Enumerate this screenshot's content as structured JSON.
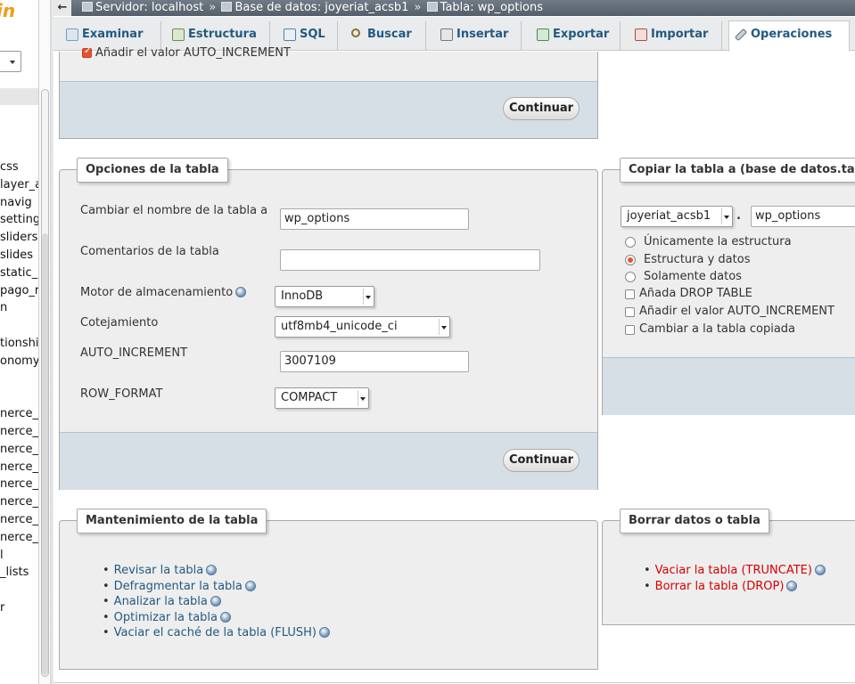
{
  "nav": {
    "logo_fragment": "in",
    "tree_items": [
      "css",
      "layer_a",
      "navig",
      "setting",
      "sliders",
      "slides",
      "static_",
      "pago_r",
      "n",
      "",
      "tionshi",
      "onomy",
      "",
      "",
      "nerce_a",
      "nerce_a",
      "nerce_c",
      "nerce_c",
      "nerce_c",
      "nerce_t",
      "nerce_t",
      "nerce_t",
      "l",
      "_lists",
      "",
      "r"
    ]
  },
  "breadcrumb": {
    "back_arrow": "←",
    "server": "Servidor: localhost",
    "sep": "»",
    "database": "Base de datos: joyeriat_acsb1",
    "table": "Tabla: wp_options"
  },
  "tabs": [
    {
      "label": "Examinar",
      "icon": "browse-icon"
    },
    {
      "label": "Estructura",
      "icon": "structure-icon"
    },
    {
      "label": "SQL",
      "icon": "sql-icon"
    },
    {
      "label": "Buscar",
      "icon": "search-icon"
    },
    {
      "label": "Insertar",
      "icon": "insert-icon"
    },
    {
      "label": "Exportar",
      "icon": "export-icon"
    },
    {
      "label": "Importar",
      "icon": "import-icon"
    },
    {
      "label": "Operaciones",
      "icon": "wrench-icon",
      "active": true
    }
  ],
  "top_section": {
    "checkbox_label": "Añadir el valor AUTO_INCREMENT",
    "button": "Continuar"
  },
  "table_options": {
    "legend": "Opciones de la tabla",
    "rename_label": "Cambiar el nombre de la tabla a",
    "rename_value": "wp_options",
    "comments_label": "Comentarios de la tabla",
    "comments_value": "",
    "engine_label": "Motor de almacenamiento",
    "engine_value": "InnoDB",
    "collation_label": "Cotejamiento",
    "collation_value": "utf8mb4_unicode_ci",
    "autoinc_label": "AUTO_INCREMENT",
    "autoinc_value": "3007109",
    "rowformat_label": "ROW_FORMAT",
    "rowformat_value": "COMPACT",
    "button": "Continuar"
  },
  "copy_table": {
    "legend": "Copiar la tabla a (base de datos.tabla):",
    "db_value": "joyeriat_acsb1",
    "dot": ".",
    "table_value": "wp_options",
    "radio_structure": "Únicamente la estructura",
    "radio_structure_data": "Estructura y datos",
    "radio_data": "Solamente datos",
    "check_drop": "Añada DROP TABLE",
    "check_autoinc": "Añadir el valor AUTO_INCREMENT",
    "check_switch": "Cambiar a la tabla copiada"
  },
  "maintenance": {
    "legend": "Mantenimiento de la tabla",
    "links": [
      "Revisar la tabla",
      "Defragmentar la tabla",
      "Analizar la tabla",
      "Optimizar la tabla",
      "Vaciar el caché de la tabla (FLUSH)"
    ]
  },
  "delete": {
    "legend": "Borrar datos o tabla",
    "links": [
      "Vaciar la tabla (TRUNCATE)",
      "Borrar la tabla (DROP)"
    ]
  },
  "colors": {
    "link": "#235a81",
    "danger": "#d60000",
    "accent": "#e5532d",
    "panel": "#eeeeee",
    "footer": "#d6dfe6"
  }
}
